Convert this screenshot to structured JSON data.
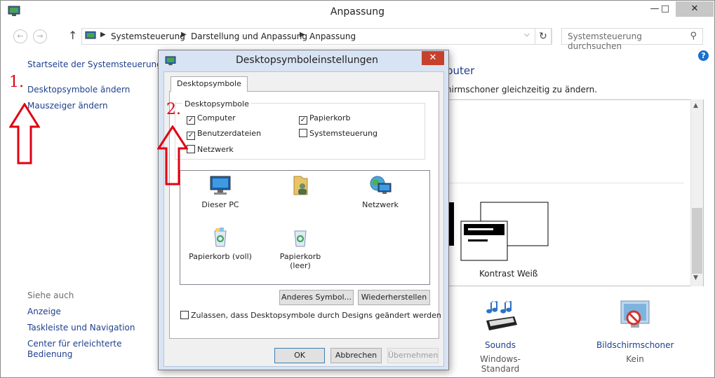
{
  "window": {
    "title": "Anpassung",
    "controls": {
      "minimize": "—",
      "maximize": "□",
      "close": "✕"
    }
  },
  "address_bar": {
    "breadcrumbs": [
      "Systemsteuerung",
      "Darstellung und Anpassung",
      "Anpassung"
    ],
    "search_placeholder": "Systemsteuerung durchsuchen"
  },
  "left_nav": {
    "home_link": "Startseite der Systemsteuerung",
    "links": [
      "Desktopsymbole ändern",
      "Mauszeiger ändern"
    ],
    "see_also_heading": "Siehe auch",
    "see_also": [
      "Anzeige",
      "Taskleiste und Navigation",
      "Center für erleichterte",
      "Bedienung"
    ]
  },
  "annotations": {
    "first": "1.",
    "second": "2."
  },
  "main": {
    "heading_fragment": "puter",
    "description_fragment": "hirmschoner gleichzeitig zu ändern.",
    "selected_theme_label": "Kontrast Weiß",
    "bottom_items": [
      {
        "label": "Sounds",
        "value": "Windows-Standard"
      },
      {
        "label": "Bildschirmschoner",
        "value": "Kein"
      }
    ]
  },
  "dialog": {
    "title": "Desktopsymboleinstellungen",
    "tab": "Desktopsymbole",
    "group_label": "Desktopsymbole",
    "checkboxes": [
      {
        "label": "Computer",
        "checked": true
      },
      {
        "label": "Papierkorb",
        "checked": true
      },
      {
        "label": "Benutzerdateien",
        "checked": true
      },
      {
        "label": "Systemsteuerung",
        "checked": false
      },
      {
        "label": "Netzwerk",
        "checked": false
      }
    ],
    "icons": [
      {
        "label": "Dieser PC",
        "icon": "monitor-icon"
      },
      {
        "label": "",
        "icon": "user-folder-icon"
      },
      {
        "label": "Netzwerk",
        "icon": "network-globe-icon"
      },
      {
        "label": "Papierkorb (voll)",
        "icon": "recycle-bin-full-icon"
      },
      {
        "label": "Papierkorb (leer)",
        "icon": "recycle-bin-empty-icon"
      }
    ],
    "buttons": {
      "change_icon": "Anderes Symbol...",
      "restore": "Wiederherstellen",
      "ok": "OK",
      "cancel": "Abbrechen",
      "apply": "Übernehmen"
    },
    "allow_themes_label": "Zulassen, dass Desktopsymbole durch Designs geändert werden",
    "allow_themes_checked": false
  },
  "colors": {
    "link": "#1e3f8e",
    "annotation": "#e10012",
    "dialog_frame": "#d8e3f3",
    "close_red": "#c7402c"
  }
}
